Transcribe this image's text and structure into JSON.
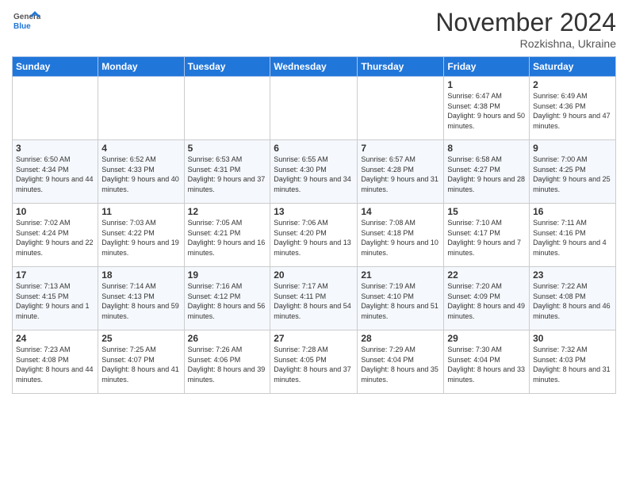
{
  "header": {
    "logo_general": "General",
    "logo_blue": "Blue",
    "month_title": "November 2024",
    "location": "Rozkishna, Ukraine"
  },
  "days_of_week": [
    "Sunday",
    "Monday",
    "Tuesday",
    "Wednesday",
    "Thursday",
    "Friday",
    "Saturday"
  ],
  "weeks": [
    [
      {
        "day": "",
        "info": ""
      },
      {
        "day": "",
        "info": ""
      },
      {
        "day": "",
        "info": ""
      },
      {
        "day": "",
        "info": ""
      },
      {
        "day": "",
        "info": ""
      },
      {
        "day": "1",
        "info": "Sunrise: 6:47 AM\nSunset: 4:38 PM\nDaylight: 9 hours and 50 minutes."
      },
      {
        "day": "2",
        "info": "Sunrise: 6:49 AM\nSunset: 4:36 PM\nDaylight: 9 hours and 47 minutes."
      }
    ],
    [
      {
        "day": "3",
        "info": "Sunrise: 6:50 AM\nSunset: 4:34 PM\nDaylight: 9 hours and 44 minutes."
      },
      {
        "day": "4",
        "info": "Sunrise: 6:52 AM\nSunset: 4:33 PM\nDaylight: 9 hours and 40 minutes."
      },
      {
        "day": "5",
        "info": "Sunrise: 6:53 AM\nSunset: 4:31 PM\nDaylight: 9 hours and 37 minutes."
      },
      {
        "day": "6",
        "info": "Sunrise: 6:55 AM\nSunset: 4:30 PM\nDaylight: 9 hours and 34 minutes."
      },
      {
        "day": "7",
        "info": "Sunrise: 6:57 AM\nSunset: 4:28 PM\nDaylight: 9 hours and 31 minutes."
      },
      {
        "day": "8",
        "info": "Sunrise: 6:58 AM\nSunset: 4:27 PM\nDaylight: 9 hours and 28 minutes."
      },
      {
        "day": "9",
        "info": "Sunrise: 7:00 AM\nSunset: 4:25 PM\nDaylight: 9 hours and 25 minutes."
      }
    ],
    [
      {
        "day": "10",
        "info": "Sunrise: 7:02 AM\nSunset: 4:24 PM\nDaylight: 9 hours and 22 minutes."
      },
      {
        "day": "11",
        "info": "Sunrise: 7:03 AM\nSunset: 4:22 PM\nDaylight: 9 hours and 19 minutes."
      },
      {
        "day": "12",
        "info": "Sunrise: 7:05 AM\nSunset: 4:21 PM\nDaylight: 9 hours and 16 minutes."
      },
      {
        "day": "13",
        "info": "Sunrise: 7:06 AM\nSunset: 4:20 PM\nDaylight: 9 hours and 13 minutes."
      },
      {
        "day": "14",
        "info": "Sunrise: 7:08 AM\nSunset: 4:18 PM\nDaylight: 9 hours and 10 minutes."
      },
      {
        "day": "15",
        "info": "Sunrise: 7:10 AM\nSunset: 4:17 PM\nDaylight: 9 hours and 7 minutes."
      },
      {
        "day": "16",
        "info": "Sunrise: 7:11 AM\nSunset: 4:16 PM\nDaylight: 9 hours and 4 minutes."
      }
    ],
    [
      {
        "day": "17",
        "info": "Sunrise: 7:13 AM\nSunset: 4:15 PM\nDaylight: 9 hours and 1 minute."
      },
      {
        "day": "18",
        "info": "Sunrise: 7:14 AM\nSunset: 4:13 PM\nDaylight: 8 hours and 59 minutes."
      },
      {
        "day": "19",
        "info": "Sunrise: 7:16 AM\nSunset: 4:12 PM\nDaylight: 8 hours and 56 minutes."
      },
      {
        "day": "20",
        "info": "Sunrise: 7:17 AM\nSunset: 4:11 PM\nDaylight: 8 hours and 54 minutes."
      },
      {
        "day": "21",
        "info": "Sunrise: 7:19 AM\nSunset: 4:10 PM\nDaylight: 8 hours and 51 minutes."
      },
      {
        "day": "22",
        "info": "Sunrise: 7:20 AM\nSunset: 4:09 PM\nDaylight: 8 hours and 49 minutes."
      },
      {
        "day": "23",
        "info": "Sunrise: 7:22 AM\nSunset: 4:08 PM\nDaylight: 8 hours and 46 minutes."
      }
    ],
    [
      {
        "day": "24",
        "info": "Sunrise: 7:23 AM\nSunset: 4:08 PM\nDaylight: 8 hours and 44 minutes."
      },
      {
        "day": "25",
        "info": "Sunrise: 7:25 AM\nSunset: 4:07 PM\nDaylight: 8 hours and 41 minutes."
      },
      {
        "day": "26",
        "info": "Sunrise: 7:26 AM\nSunset: 4:06 PM\nDaylight: 8 hours and 39 minutes."
      },
      {
        "day": "27",
        "info": "Sunrise: 7:28 AM\nSunset: 4:05 PM\nDaylight: 8 hours and 37 minutes."
      },
      {
        "day": "28",
        "info": "Sunrise: 7:29 AM\nSunset: 4:04 PM\nDaylight: 8 hours and 35 minutes."
      },
      {
        "day": "29",
        "info": "Sunrise: 7:30 AM\nSunset: 4:04 PM\nDaylight: 8 hours and 33 minutes."
      },
      {
        "day": "30",
        "info": "Sunrise: 7:32 AM\nSunset: 4:03 PM\nDaylight: 8 hours and 31 minutes."
      }
    ]
  ]
}
